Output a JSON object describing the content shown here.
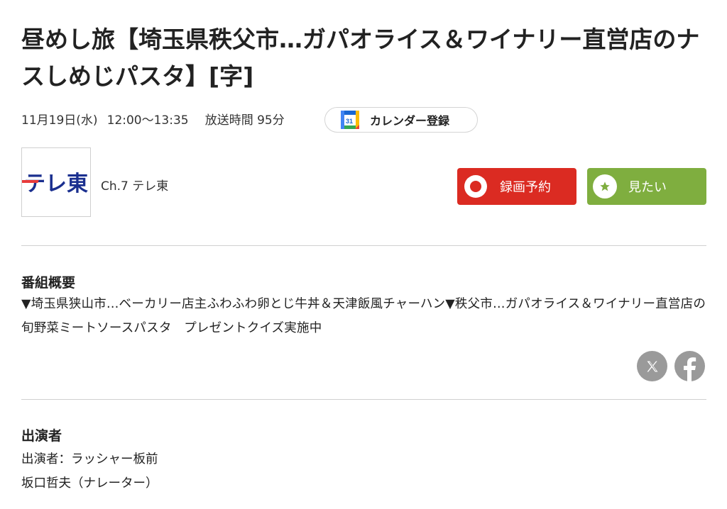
{
  "program": {
    "title": "昼めし旅【埼玉県秩父市…ガパオライス＆ワイナリー直営店のナスしめじパスタ】[字]",
    "date": "11月19日(水)",
    "time": "12:00〜13:35",
    "duration": "放送時間 95分",
    "calendar_button": "カレンダー登録",
    "calendar_icon_number": "31"
  },
  "channel": {
    "logo_text": "テレ東",
    "name": "Ch.7 テレ東"
  },
  "actions": {
    "record_label": "録画予約",
    "want_label": "見たい"
  },
  "overview": {
    "heading": "番組概要",
    "body": "▼埼玉県狭山市…ベーカリー店主ふわふわ卵とじ牛丼＆天津飯風チャーハン▼秩父市…ガパオライス＆ワイナリー直営店の旬野菜ミートソースパスタ　プレゼントクイズ実施中"
  },
  "share": {
    "x_icon": "x-icon",
    "facebook_icon": "facebook-icon"
  },
  "cast": {
    "heading": "出演者",
    "lines": [
      "出演者：ラッシャー板前",
      "坂口哲夫（ナレーター）"
    ]
  },
  "colors": {
    "record": "#db2b22",
    "want": "#7fae3f",
    "tvtokyo_blue": "#1a2f8f",
    "tvtokyo_red": "#e83b3b",
    "sns_gray": "#9a9a9a"
  }
}
